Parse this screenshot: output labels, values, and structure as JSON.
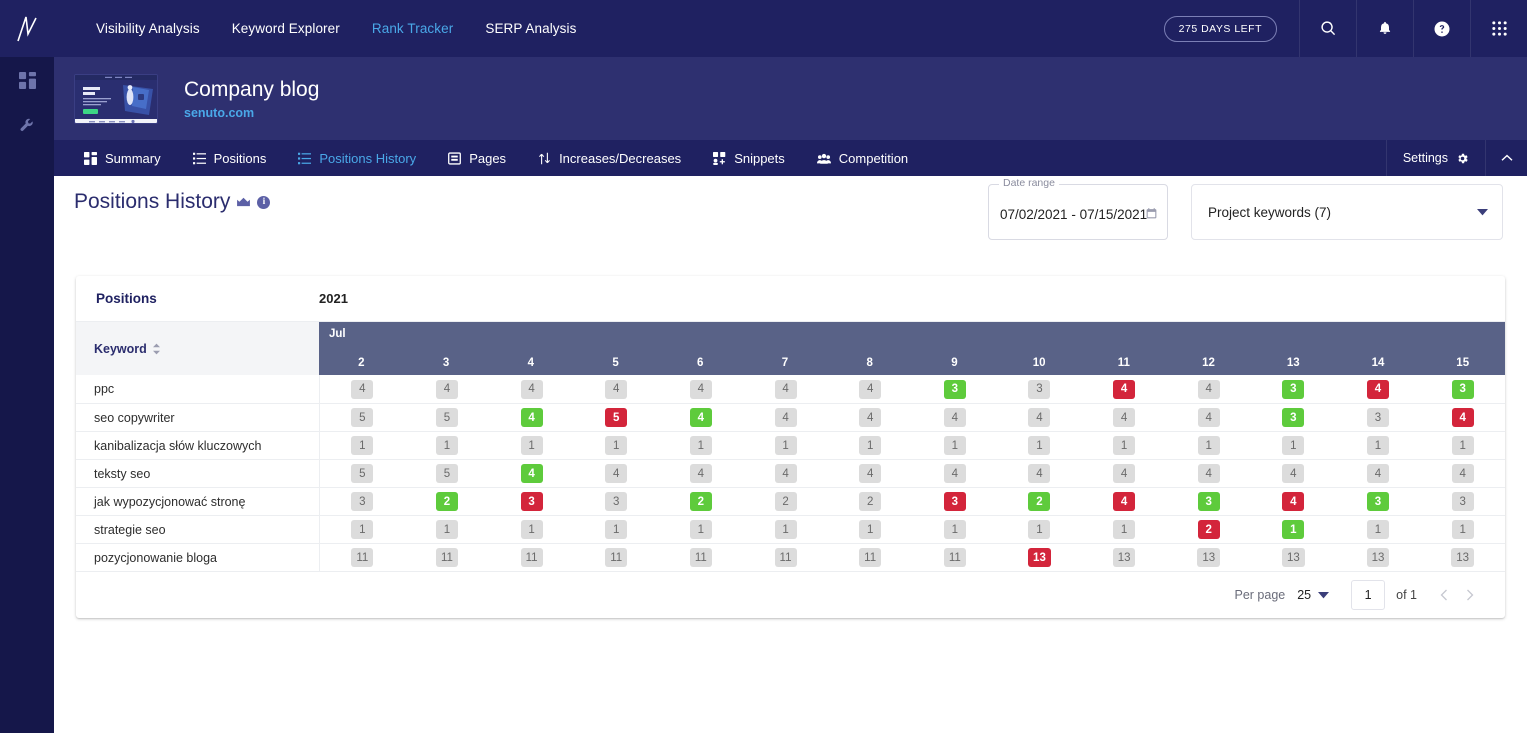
{
  "topnav": {
    "logo": "senuto-logo",
    "links": [
      {
        "label": "Visibility Analysis",
        "active": false
      },
      {
        "label": "Keyword Explorer",
        "active": false
      },
      {
        "label": "Rank Tracker",
        "active": true
      },
      {
        "label": "SERP Analysis",
        "active": false
      }
    ],
    "trial_badge": "275 DAYS LEFT",
    "icons": [
      "search-icon",
      "bell-icon",
      "help-icon",
      "apps-grid-icon"
    ]
  },
  "rail": {
    "items": [
      "dashboard-icon",
      "wrench-icon"
    ]
  },
  "project": {
    "title": "Company blog",
    "domain": "senuto.com",
    "thumbnail": "project-preview-thumbnail"
  },
  "tabs": [
    {
      "label": "Summary",
      "icon": "grid-icon",
      "active": false
    },
    {
      "label": "Positions",
      "icon": "list-icon",
      "active": false
    },
    {
      "label": "Positions History",
      "icon": "list-icon",
      "active": true
    },
    {
      "label": "Pages",
      "icon": "page-icon",
      "active": false
    },
    {
      "label": "Increases/Decreases",
      "icon": "arrows-updown-icon",
      "active": false
    },
    {
      "label": "Snippets",
      "icon": "snippets-icon",
      "active": false
    },
    {
      "label": "Competition",
      "icon": "people-icon",
      "active": false
    }
  ],
  "tabbar_right": {
    "settings_label": "Settings",
    "settings_icon": "gear-icon",
    "collapse_icon": "chevron-up-icon"
  },
  "page": {
    "title": "Positions History",
    "crown_icon": "crown-icon",
    "info_icon": "info-icon",
    "info_glyph": "i"
  },
  "filters": {
    "date_label": "Date range",
    "date_value": "07/02/2021 - 07/15/2021",
    "calendar_icon": "calendar-icon",
    "keyword_select_value": "Project keywords (7)",
    "caret_icon": "chevron-down-icon"
  },
  "table": {
    "head_left": "Positions",
    "head_year": "2021",
    "keyword_col": "Keyword",
    "sort_icon": "sort-icon",
    "month": "Jul",
    "days": [
      "2",
      "3",
      "4",
      "5",
      "6",
      "7",
      "8",
      "9",
      "10",
      "11",
      "12",
      "13",
      "14",
      "15"
    ],
    "rows": [
      {
        "keyword": "ppc",
        "cells": [
          {
            "v": "4",
            "s": "neutral"
          },
          {
            "v": "4",
            "s": "neutral"
          },
          {
            "v": "4",
            "s": "neutral"
          },
          {
            "v": "4",
            "s": "neutral"
          },
          {
            "v": "4",
            "s": "neutral"
          },
          {
            "v": "4",
            "s": "neutral"
          },
          {
            "v": "4",
            "s": "neutral"
          },
          {
            "v": "3",
            "s": "up"
          },
          {
            "v": "3",
            "s": "neutral"
          },
          {
            "v": "4",
            "s": "down"
          },
          {
            "v": "4",
            "s": "neutral"
          },
          {
            "v": "3",
            "s": "up"
          },
          {
            "v": "4",
            "s": "down"
          },
          {
            "v": "3",
            "s": "up"
          }
        ]
      },
      {
        "keyword": "seo copywriter",
        "cells": [
          {
            "v": "5",
            "s": "neutral"
          },
          {
            "v": "5",
            "s": "neutral"
          },
          {
            "v": "4",
            "s": "up"
          },
          {
            "v": "5",
            "s": "down"
          },
          {
            "v": "4",
            "s": "up"
          },
          {
            "v": "4",
            "s": "neutral"
          },
          {
            "v": "4",
            "s": "neutral"
          },
          {
            "v": "4",
            "s": "neutral"
          },
          {
            "v": "4",
            "s": "neutral"
          },
          {
            "v": "4",
            "s": "neutral"
          },
          {
            "v": "4",
            "s": "neutral"
          },
          {
            "v": "3",
            "s": "up"
          },
          {
            "v": "3",
            "s": "neutral"
          },
          {
            "v": "4",
            "s": "down"
          }
        ]
      },
      {
        "keyword": "kanibalizacja słów kluczowych",
        "cells": [
          {
            "v": "1",
            "s": "neutral"
          },
          {
            "v": "1",
            "s": "neutral"
          },
          {
            "v": "1",
            "s": "neutral"
          },
          {
            "v": "1",
            "s": "neutral"
          },
          {
            "v": "1",
            "s": "neutral"
          },
          {
            "v": "1",
            "s": "neutral"
          },
          {
            "v": "1",
            "s": "neutral"
          },
          {
            "v": "1",
            "s": "neutral"
          },
          {
            "v": "1",
            "s": "neutral"
          },
          {
            "v": "1",
            "s": "neutral"
          },
          {
            "v": "1",
            "s": "neutral"
          },
          {
            "v": "1",
            "s": "neutral"
          },
          {
            "v": "1",
            "s": "neutral"
          },
          {
            "v": "1",
            "s": "neutral"
          }
        ]
      },
      {
        "keyword": "teksty seo",
        "cells": [
          {
            "v": "5",
            "s": "neutral"
          },
          {
            "v": "5",
            "s": "neutral"
          },
          {
            "v": "4",
            "s": "up"
          },
          {
            "v": "4",
            "s": "neutral"
          },
          {
            "v": "4",
            "s": "neutral"
          },
          {
            "v": "4",
            "s": "neutral"
          },
          {
            "v": "4",
            "s": "neutral"
          },
          {
            "v": "4",
            "s": "neutral"
          },
          {
            "v": "4",
            "s": "neutral"
          },
          {
            "v": "4",
            "s": "neutral"
          },
          {
            "v": "4",
            "s": "neutral"
          },
          {
            "v": "4",
            "s": "neutral"
          },
          {
            "v": "4",
            "s": "neutral"
          },
          {
            "v": "4",
            "s": "neutral"
          }
        ]
      },
      {
        "keyword": "jak wypozycjonować stronę",
        "cells": [
          {
            "v": "3",
            "s": "neutral"
          },
          {
            "v": "2",
            "s": "up"
          },
          {
            "v": "3",
            "s": "down"
          },
          {
            "v": "3",
            "s": "neutral"
          },
          {
            "v": "2",
            "s": "up"
          },
          {
            "v": "2",
            "s": "neutral"
          },
          {
            "v": "2",
            "s": "neutral"
          },
          {
            "v": "3",
            "s": "down"
          },
          {
            "v": "2",
            "s": "up"
          },
          {
            "v": "4",
            "s": "down"
          },
          {
            "v": "3",
            "s": "up"
          },
          {
            "v": "4",
            "s": "down"
          },
          {
            "v": "3",
            "s": "up"
          },
          {
            "v": "3",
            "s": "neutral"
          }
        ]
      },
      {
        "keyword": "strategie seo",
        "cells": [
          {
            "v": "1",
            "s": "neutral"
          },
          {
            "v": "1",
            "s": "neutral"
          },
          {
            "v": "1",
            "s": "neutral"
          },
          {
            "v": "1",
            "s": "neutral"
          },
          {
            "v": "1",
            "s": "neutral"
          },
          {
            "v": "1",
            "s": "neutral"
          },
          {
            "v": "1",
            "s": "neutral"
          },
          {
            "v": "1",
            "s": "neutral"
          },
          {
            "v": "1",
            "s": "neutral"
          },
          {
            "v": "1",
            "s": "neutral"
          },
          {
            "v": "2",
            "s": "down"
          },
          {
            "v": "1",
            "s": "up"
          },
          {
            "v": "1",
            "s": "neutral"
          },
          {
            "v": "1",
            "s": "neutral"
          }
        ]
      },
      {
        "keyword": "pozycjonowanie bloga",
        "cells": [
          {
            "v": "11",
            "s": "neutral"
          },
          {
            "v": "11",
            "s": "neutral"
          },
          {
            "v": "11",
            "s": "neutral"
          },
          {
            "v": "11",
            "s": "neutral"
          },
          {
            "v": "11",
            "s": "neutral"
          },
          {
            "v": "11",
            "s": "neutral"
          },
          {
            "v": "11",
            "s": "neutral"
          },
          {
            "v": "11",
            "s": "neutral"
          },
          {
            "v": "13",
            "s": "down"
          },
          {
            "v": "13",
            "s": "neutral"
          },
          {
            "v": "13",
            "s": "neutral"
          },
          {
            "v": "13",
            "s": "neutral"
          },
          {
            "v": "13",
            "s": "neutral"
          },
          {
            "v": "13",
            "s": "neutral"
          }
        ]
      }
    ],
    "footer": {
      "per_page_label": "Per page",
      "per_page_value": "25",
      "page_value": "1",
      "of_label": "of 1",
      "prev_icon": "chevron-left-icon",
      "next_icon": "chevron-right-icon"
    }
  },
  "colors": {
    "nav_bg": "#1f2161",
    "rail_bg": "#15174a",
    "proj_bg": "#2e3070",
    "accent": "#4aa8e8",
    "table_head": "#596287",
    "up": "#5ecb3c",
    "down": "#d3253b",
    "neutral": "#dcdcdc"
  }
}
